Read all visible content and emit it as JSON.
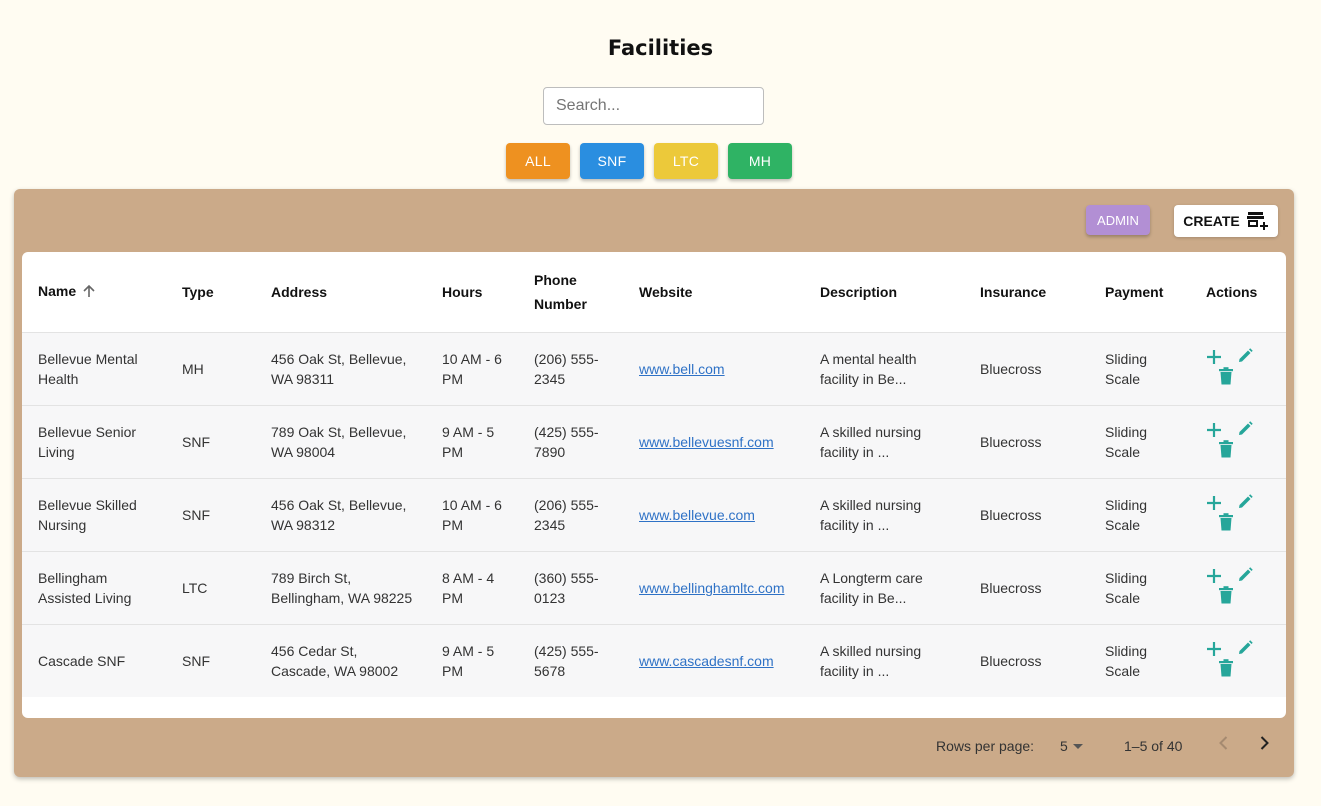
{
  "page": {
    "title": "Facilities"
  },
  "search": {
    "placeholder": "Search..."
  },
  "filters": [
    {
      "label": "ALL",
      "color": "#ee9120"
    },
    {
      "label": "SNF",
      "color": "#2a8ee0"
    },
    {
      "label": "LTC",
      "color": "#ecc93a"
    },
    {
      "label": "MH",
      "color": "#2fb364"
    }
  ],
  "toolbar": {
    "admin_label": "ADMIN",
    "create_label": "CREATE"
  },
  "table": {
    "columns": [
      "Name",
      "Type",
      "Address",
      "Hours",
      "Phone Number",
      "Website",
      "Description",
      "Insurance",
      "Payment",
      "Actions"
    ],
    "sort_column": "Name",
    "sort_direction": "asc",
    "rows": [
      {
        "name": "Bellevue Mental Health",
        "type": "MH",
        "address": "456 Oak St, Bellevue, WA 98311",
        "hours": "10 AM - 6 PM",
        "phone": "(206) 555-2345",
        "website": "www.bell.com",
        "description": "A mental health facility in Be...",
        "insurance": "Bluecross",
        "payment": "Sliding Scale"
      },
      {
        "name": "Bellevue Senior Living",
        "type": "SNF",
        "address": "789 Oak St, Bellevue, WA 98004",
        "hours": "9 AM - 5 PM",
        "phone": "(425) 555-7890",
        "website": "www.bellevuesnf.com",
        "description": "A skilled nursing facility in ...",
        "insurance": "Bluecross",
        "payment": "Sliding Scale"
      },
      {
        "name": "Bellevue Skilled Nursing",
        "type": "SNF",
        "address": "456 Oak St, Bellevue, WA 98312",
        "hours": "10 AM - 6 PM",
        "phone": "(206) 555-2345",
        "website": "www.bellevue.com",
        "description": "A skilled nursing facility in ...",
        "insurance": "Bluecross",
        "payment": "Sliding Scale"
      },
      {
        "name": "Bellingham Assisted Living",
        "type": "LTC",
        "address": "789 Birch St, Bellingham, WA 98225",
        "hours": "8 AM - 4 PM",
        "phone": "(360) 555-0123",
        "website": "www.bellinghamltc.com",
        "description": "A Longterm care facility in Be...",
        "insurance": "Bluecross",
        "payment": "Sliding Scale"
      },
      {
        "name": "Cascade SNF",
        "type": "SNF",
        "address": "456 Cedar St, Cascade, WA 98002",
        "hours": "9 AM - 5 PM",
        "phone": "(425) 555-5678",
        "website": "www.cascadesnf.com",
        "description": "A skilled nursing facility in ...",
        "insurance": "Bluecross",
        "payment": "Sliding Scale"
      }
    ]
  },
  "pagination": {
    "rows_per_page_label": "Rows per page:",
    "rows_per_page": "5",
    "range": "1–5 of 40"
  },
  "colors": {
    "card": "#cbaa89",
    "admin": "#b28fd4",
    "action_icon": "#26a69a",
    "link": "#2f72c6"
  }
}
